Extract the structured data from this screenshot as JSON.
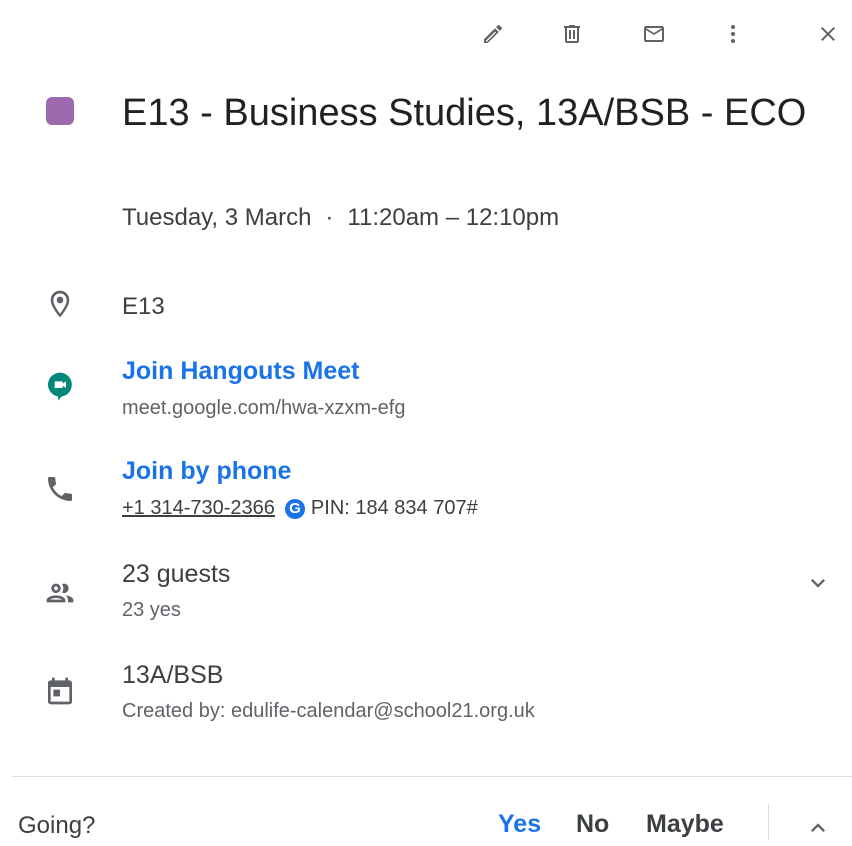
{
  "toolbar": {
    "edit_icon": "pencil-icon",
    "delete_icon": "trash-icon",
    "email_icon": "envelope-icon",
    "more_icon": "more-vertical-icon",
    "close_icon": "close-icon"
  },
  "event": {
    "color": "#9e69af",
    "title": "E13 - Business Studies, 13A/BSB - ECO",
    "date": "Tuesday, 3 March",
    "separator": "·",
    "time": "11:20am – 12:10pm"
  },
  "location": {
    "icon": "location-pin-icon",
    "text": "E13"
  },
  "meet": {
    "icon": "hangouts-meet-icon",
    "link_label": "Join Hangouts Meet",
    "url": "meet.google.com/hwa-xzxm-efg"
  },
  "phone": {
    "icon": "phone-icon",
    "link_label": "Join by phone",
    "number": "+1 314-730-2366",
    "badge": "G",
    "pin": "PIN: 184 834 707#"
  },
  "guests": {
    "icon": "people-icon",
    "count": "23 guests",
    "summary": "23 yes",
    "expand_icon": "chevron-down-icon"
  },
  "calendar": {
    "icon": "calendar-icon",
    "name": "13A/BSB",
    "creator": "Created by: edulife-calendar@school21.org.uk"
  },
  "rsvp": {
    "question": "Going?",
    "yes": "Yes",
    "no": "No",
    "maybe": "Maybe",
    "selected": "Yes",
    "collapse_icon": "chevron-up-icon"
  },
  "colors": {
    "accent": "#1a73e8",
    "meet_green": "#00897b"
  }
}
